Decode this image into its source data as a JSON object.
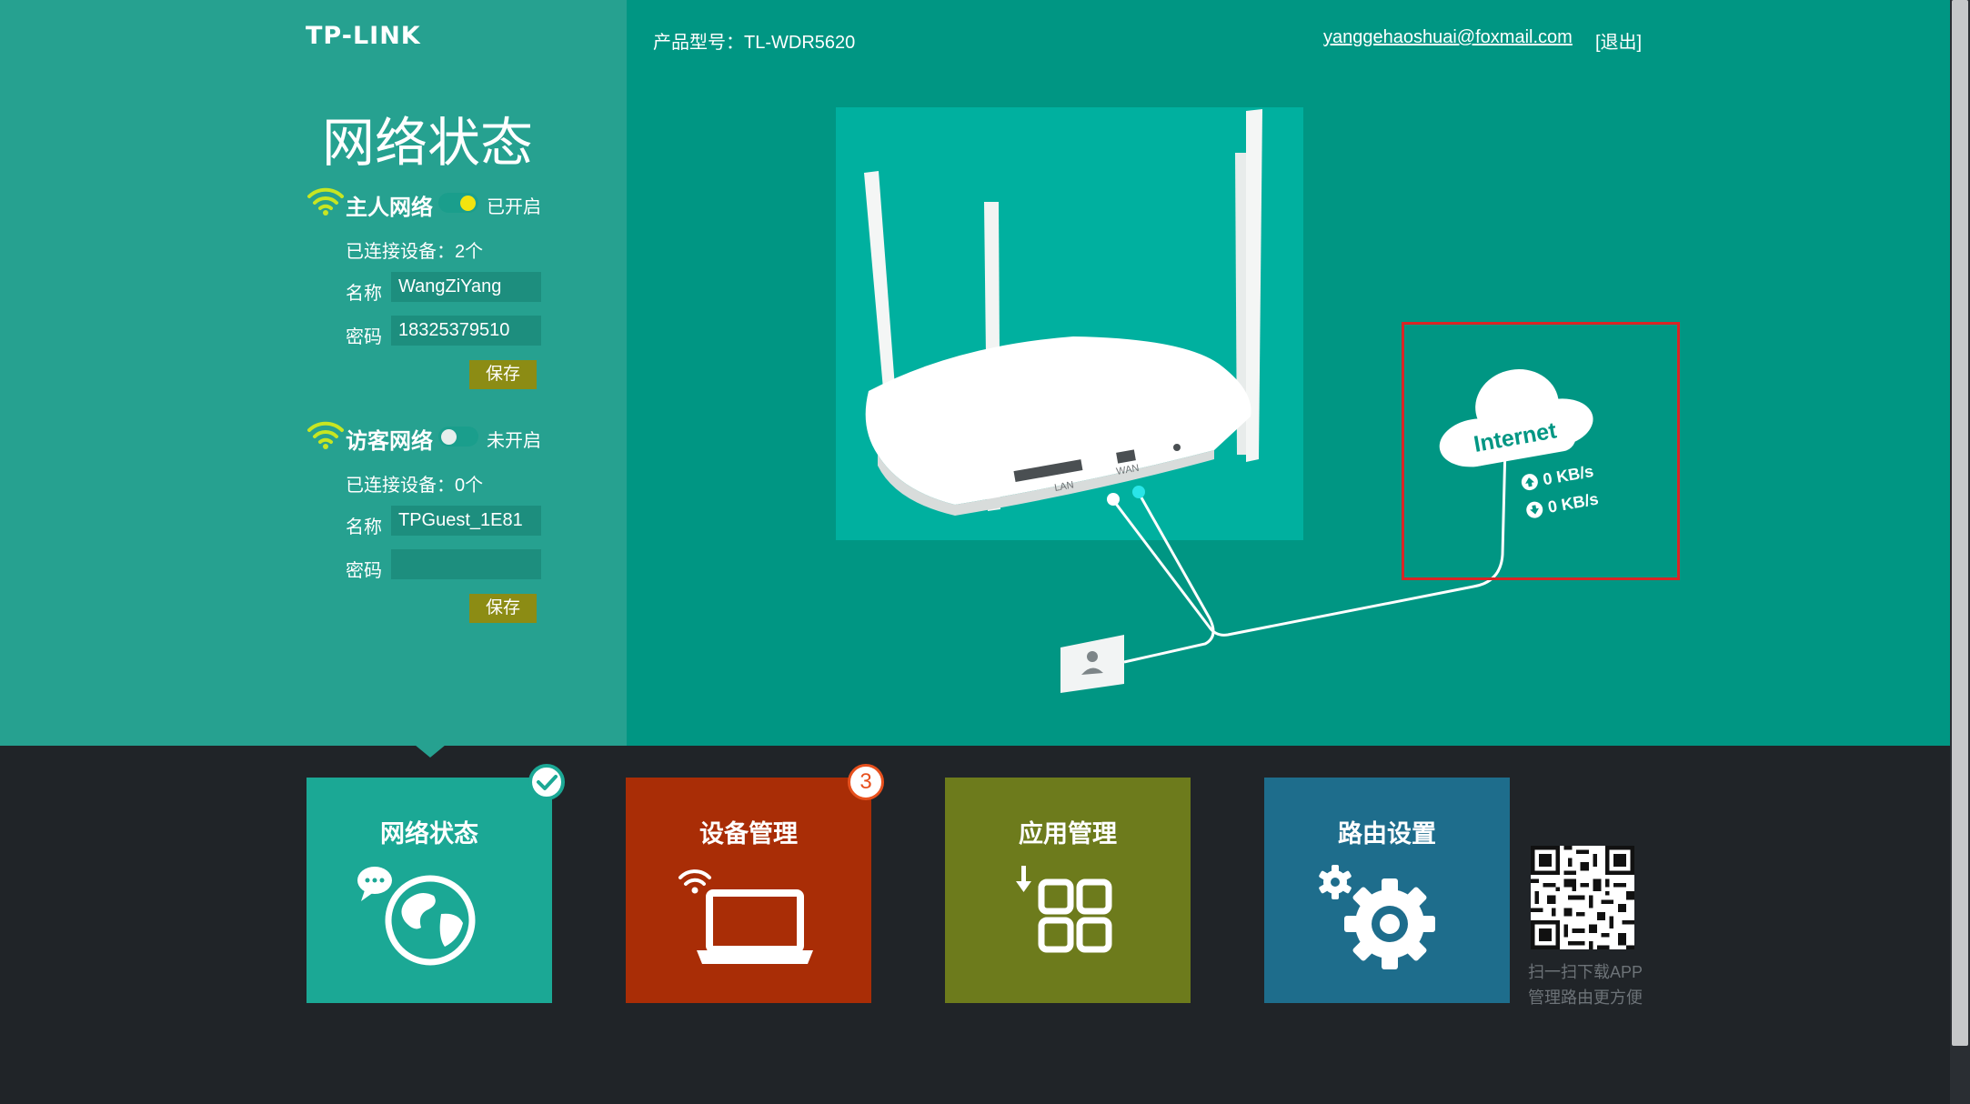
{
  "header": {
    "logo": "TP-LINK",
    "product_model": "产品型号：TL-WDR5620",
    "user_email": "yanggehaoshuai@foxmail.com",
    "logout": "[退出]"
  },
  "left_panel": {
    "title": "网络状态",
    "main_network": {
      "title": "主人网络",
      "status": "已开启",
      "enabled": true,
      "connected": "已连接设备：2个",
      "name_label": "名称",
      "name_value": "WangZiYang",
      "password_label": "密码",
      "password_value": "18325379510",
      "save_label": "保存"
    },
    "guest_network": {
      "title": "访客网络",
      "status": "未开启",
      "enabled": false,
      "connected": "已连接设备：0个",
      "name_label": "名称",
      "name_value": "TPGuest_1E81",
      "password_label": "密码",
      "password_value": "",
      "save_label": "保存"
    }
  },
  "diagram": {
    "router_labels": {
      "lan": "LAN",
      "wan": "WAN"
    },
    "internet_label": "Internet",
    "upload_speed": "0 KB/s",
    "download_speed": "0 KB/s"
  },
  "tiles": [
    {
      "title": "网络状态",
      "color": "#1ba895",
      "selected": true
    },
    {
      "title": "设备管理",
      "color": "#a92d06",
      "badge": "3"
    },
    {
      "title": "应用管理",
      "color": "#6d7b1c"
    },
    {
      "title": "路由设置",
      "color": "#1e6d8c"
    }
  ],
  "qr": {
    "line1": "扫一扫下载APP",
    "line2": "管理路由更方便"
  },
  "colors": {
    "top_bg": "#009683",
    "left_panel_bg": "#26a190",
    "bottom_bg": "#202428",
    "highlight_box": "#d92525",
    "toggle_on": "#f2e40f"
  }
}
